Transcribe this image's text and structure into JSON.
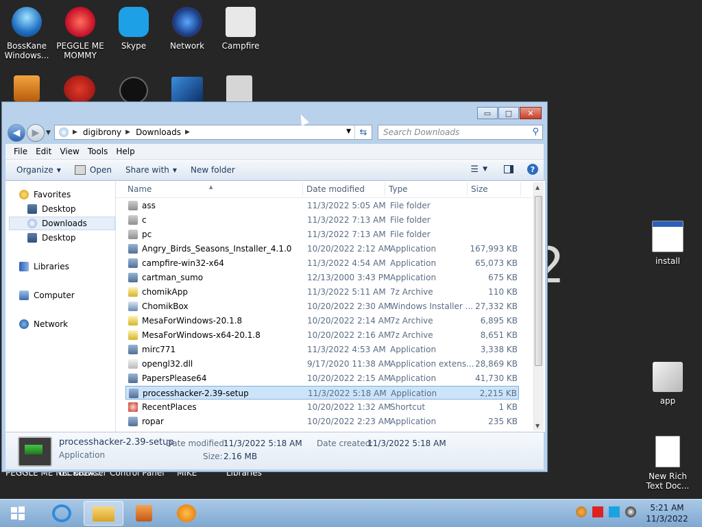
{
  "desktop": {
    "icons_top": [
      {
        "label": "BossKane Windows...",
        "icon": "bosskane-icon"
      },
      {
        "label": "PEGGLE ME MOMMY",
        "icon": "peggle-icon"
      },
      {
        "label": "Skype",
        "icon": "skype-icon"
      },
      {
        "label": "Network",
        "icon": "network-icon"
      },
      {
        "label": "Campfire",
        "icon": "campfire-icon"
      }
    ],
    "right_icons": [
      {
        "label": "install",
        "icon": "window-icon"
      },
      {
        "label": "app",
        "icon": "folder-icon"
      },
      {
        "label": "New Rich Text Doc...",
        "icon": "document-icon"
      }
    ],
    "partial_labels": [
      "PEGGLE ME NECKBEA...",
      "UC Browser",
      "Control Panel",
      "MIKE",
      "Libraries"
    ],
    "background_digit": "2"
  },
  "window": {
    "caption_buttons": {
      "minimize": "▭",
      "maximize": "□",
      "close": "✕"
    },
    "breadcrumb": [
      "digibrony",
      "Downloads"
    ],
    "search_placeholder": "Search Downloads",
    "menu": [
      "File",
      "Edit",
      "View",
      "Tools",
      "Help"
    ],
    "commands": {
      "organize": "Organize",
      "open": "Open",
      "share_with": "Share with",
      "new_folder": "New folder"
    },
    "nav": {
      "favorites": "Favorites",
      "favorites_items": [
        "Desktop",
        "Downloads",
        "Desktop"
      ],
      "libraries": "Libraries",
      "computer": "Computer",
      "network": "Network"
    },
    "columns": {
      "name": "Name",
      "date": "Date modified",
      "type": "Type",
      "size": "Size"
    },
    "files": [
      {
        "name": "ass",
        "date": "11/3/2022 5:05 AM",
        "type": "File folder",
        "size": "",
        "icon": "folder"
      },
      {
        "name": "c",
        "date": "11/3/2022 7:13 AM",
        "type": "File folder",
        "size": "",
        "icon": "folder"
      },
      {
        "name": "pc",
        "date": "11/3/2022 7:13 AM",
        "type": "File folder",
        "size": "",
        "icon": "folder"
      },
      {
        "name": "Angry_Birds_Seasons_Installer_4.1.0",
        "date": "10/20/2022 2:12 AM",
        "type": "Application",
        "size": "167,993 KB",
        "icon": "app"
      },
      {
        "name": "campfire-win32-x64",
        "date": "11/3/2022 4:54 AM",
        "type": "Application",
        "size": "65,073 KB",
        "icon": "app"
      },
      {
        "name": "cartman_sumo",
        "date": "12/13/2000 3:43 PM",
        "type": "Application",
        "size": "675 KB",
        "icon": "app"
      },
      {
        "name": "chomikApp",
        "date": "11/3/2022 5:11 AM",
        "type": "7z Archive",
        "size": "110 KB",
        "icon": "archive"
      },
      {
        "name": "ChomikBox",
        "date": "10/20/2022 2:30 AM",
        "type": "Windows Installer ...",
        "size": "27,332 KB",
        "icon": "installer"
      },
      {
        "name": "MesaForWindows-20.1.8",
        "date": "10/20/2022 2:14 AM",
        "type": "7z Archive",
        "size": "6,895 KB",
        "icon": "archive"
      },
      {
        "name": "MesaForWindows-x64-20.1.8",
        "date": "10/20/2022 2:16 AM",
        "type": "7z Archive",
        "size": "8,651 KB",
        "icon": "archive"
      },
      {
        "name": "mirc771",
        "date": "11/3/2022 4:53 AM",
        "type": "Application",
        "size": "3,338 KB",
        "icon": "app"
      },
      {
        "name": "opengl32.dll",
        "date": "9/17/2020 11:38 AM",
        "type": "Application extens...",
        "size": "28,869 KB",
        "icon": "dll"
      },
      {
        "name": "PapersPlease64",
        "date": "10/20/2022 2:15 AM",
        "type": "Application",
        "size": "41,730 KB",
        "icon": "app"
      },
      {
        "name": "processhacker-2.39-setup",
        "date": "11/3/2022 5:18 AM",
        "type": "Application",
        "size": "2,215 KB",
        "icon": "app",
        "selected": true
      },
      {
        "name": "RecentPlaces",
        "date": "10/20/2022 1:32 AM",
        "type": "Shortcut",
        "size": "1 KB",
        "icon": "shortcut"
      },
      {
        "name": "ropar",
        "date": "10/20/2022 2:23 AM",
        "type": "Application",
        "size": "235 KB",
        "icon": "app"
      }
    ],
    "details": {
      "name": "processhacker-2.39-setup",
      "type": "Application",
      "date_modified_label": "Date modified:",
      "date_modified": "11/3/2022 5:18 AM",
      "date_created_label": "Date created:",
      "date_created": "11/3/2022 5:18 AM",
      "size_label": "Size:",
      "size": "2.16 MB"
    }
  },
  "taskbar": {
    "time": "5:21 AM",
    "date": "11/3/2022"
  },
  "colors": {
    "desktop_bg": "#262626",
    "window_chrome": "#b9d1ea",
    "selection": "#cce4fa",
    "taskbar": "#7fa8d1",
    "close_button": "#c7402c"
  }
}
